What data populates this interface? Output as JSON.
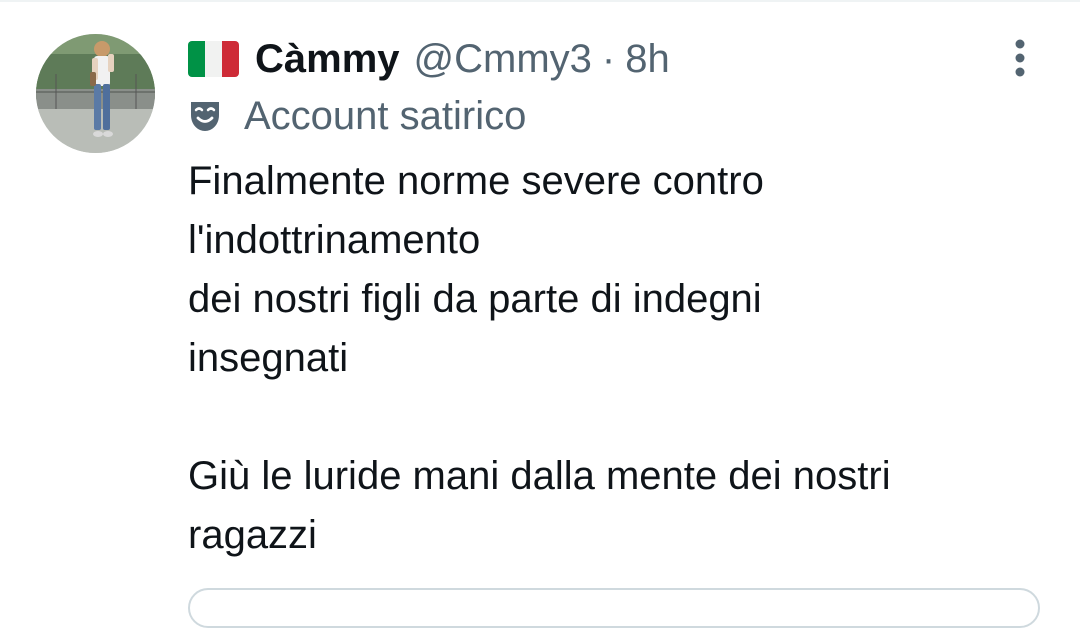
{
  "tweet": {
    "flag_icon": "italy-flag-icon",
    "display_name": "Càmmy",
    "handle": "@Cmmy3",
    "separator": "·",
    "time": "8h",
    "label_icon": "theater-mask-icon",
    "label_text": "Account satirico",
    "more_icon": "vertical-dots-icon",
    "text_lines": [
      "Finalmente norme severe contro",
      "l'indottrinamento",
      "dei nostri figli da parte di indegni",
      "insegnati",
      "",
      "Giù le luride mani dalla mente dei nostri",
      "ragazzi"
    ]
  },
  "colors": {
    "primary_text": "#0f1419",
    "secondary_text": "#536471",
    "divider": "#eff3f4",
    "card_border": "#cfd9de"
  }
}
